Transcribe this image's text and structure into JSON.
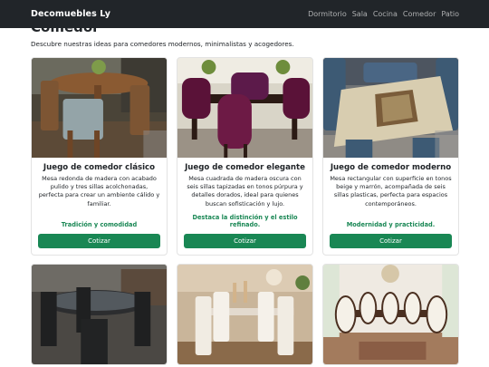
{
  "nav": {
    "brand": "Decomuebles Ly",
    "links": [
      "Dormitorio",
      "Sala",
      "Cocina",
      "Comedor",
      "Patio"
    ]
  },
  "section": {
    "title": "Comedor",
    "intro": "Descubre nuestras ideas para comedores modernos, minimalistas y acogedores."
  },
  "cards": [
    {
      "title": "Juego de comedor clásico",
      "text": "Mesa redonda de madera con acabado pulido y tres sillas acolchonadas, perfecta para crear un ambiente cálido y familiar.",
      "benefit": "Tradición y comodidad",
      "button": "Cotizar"
    },
    {
      "title": "Juego de comedor elegante",
      "text": "Mesa cuadrada de madera oscura con seis sillas tapizadas en tonos púrpura y detalles dorados, ideal para quienes buscan sofisticación y lujo.",
      "benefit": "Destaca la distinción y el estilo refinado.",
      "button": "Cotizar"
    },
    {
      "title": "Juego de comedor moderno",
      "text": "Mesa rectangular con superficie en tonos beige y marrón, acompañada de seis sillas plasticas, perfecta para espacios contemporáneos.",
      "benefit": "Modernidad y practicidad.",
      "button": "Cotizar"
    }
  ],
  "colors": {
    "navbar": "#212529",
    "accent": "#198754"
  }
}
